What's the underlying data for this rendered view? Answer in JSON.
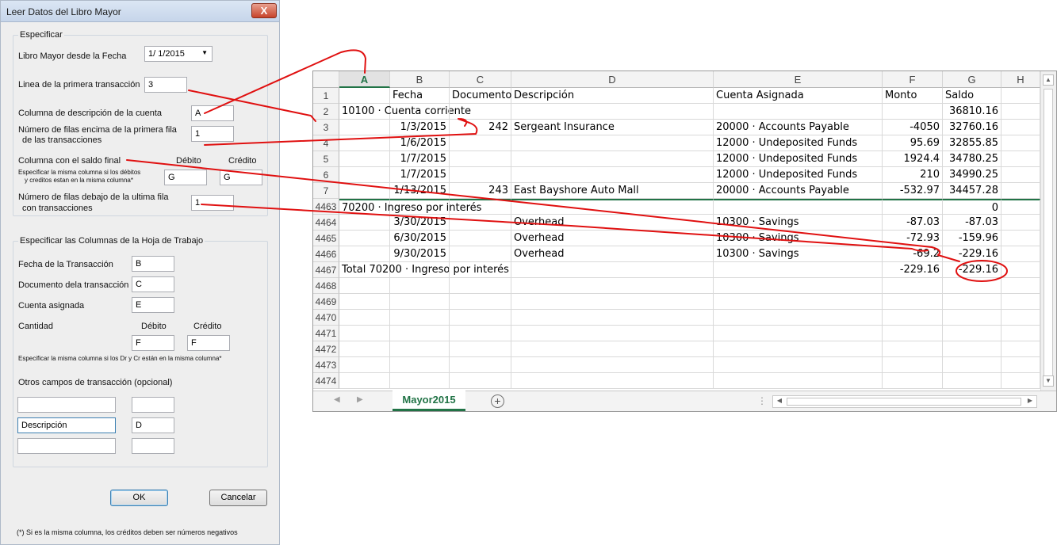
{
  "dialog": {
    "title": "Leer Datos del Libro Mayor",
    "close_label": "X",
    "specify": {
      "legend": "Especificar",
      "ledger_from_date_label": "Libro Mayor desde la Fecha",
      "ledger_from_date_value": "1/  1/2015",
      "first_transaction_line_label": "Linea de la primera transacción",
      "first_transaction_line_value": "3",
      "account_description_column_label": "Columna de descripción de la cuenta",
      "account_description_column_value": "A",
      "rows_above_label_1": "Número de filas encima de la primera fila",
      "rows_above_label_2": "de las transacciones",
      "rows_above_value": "1",
      "final_balance_column_label": "Columna con el saldo final",
      "debit_label": "Débito",
      "credit_label": "Crédito",
      "same_column_note_1": "Especificar la misma columna si los débitos",
      "same_column_note_2": "y creditos estan en la misma columna*",
      "final_balance_debit_value": "G",
      "final_balance_credit_value": "G",
      "rows_below_label_1": "Número de filas debajo de la ultima fila",
      "rows_below_label_2": "con transacciones",
      "rows_below_value": "1"
    },
    "worksheet_columns": {
      "legend": "Especificar las Columnas de la Hoja de Trabajo",
      "transaction_date_label": "Fecha de la Transacción",
      "transaction_date_value": "B",
      "transaction_document_label": "Documento dela transacción",
      "transaction_document_value": "C",
      "assigned_account_label": "Cuenta asignada",
      "assigned_account_value": "E",
      "amount_label": "Cantidad",
      "debit_label": "Débito",
      "credit_label": "Crédito",
      "amount_debit_value": "F",
      "amount_credit_value": "F",
      "same_column_note": "Especificar la misma columna si los Dr y Cr están en la misma columna*",
      "other_fields_label": "Otros campos de transacción (opcional)",
      "other_fields": [
        {
          "name": "",
          "column": ""
        },
        {
          "name": "Descripción",
          "column": "D"
        },
        {
          "name": "",
          "column": ""
        }
      ]
    },
    "ok_label": "OK",
    "cancel_label": "Cancelar",
    "footnote": "(*) Si es la misma columna, los créditos deben ser números negativos"
  },
  "sheet": {
    "columns": [
      "A",
      "B",
      "C",
      "D",
      "E",
      "F",
      "G",
      "H"
    ],
    "selected_column": "A",
    "rows": [
      {
        "num": "1",
        "a": "",
        "b": "Fecha",
        "c": "Documento",
        "d": "Descripción",
        "e": "Cuenta Asignada",
        "f": "Monto",
        "g": "Saldo"
      },
      {
        "num": "2",
        "a": "10100 · Cuenta corriente",
        "b": "",
        "c": "",
        "d": "",
        "e": "",
        "f": "",
        "g": "36810.16"
      },
      {
        "num": "3",
        "a": "",
        "b": "1/3/2015",
        "c": "242",
        "d": "Sergeant Insurance",
        "e": "20000 · Accounts Payable",
        "f": "-4050",
        "g": "32760.16"
      },
      {
        "num": "4",
        "a": "",
        "b": "1/6/2015",
        "c": "",
        "d": "",
        "e": "12000 · Undeposited Funds",
        "f": "95.69",
        "g": "32855.85"
      },
      {
        "num": "5",
        "a": "",
        "b": "1/7/2015",
        "c": "",
        "d": "",
        "e": "12000 · Undeposited Funds",
        "f": "1924.4",
        "g": "34780.25"
      },
      {
        "num": "6",
        "a": "",
        "b": "1/7/2015",
        "c": "",
        "d": "",
        "e": "12000 · Undeposited Funds",
        "f": "210",
        "g": "34990.25"
      },
      {
        "num": "7",
        "a": "",
        "b": "1/13/2015",
        "c": "243",
        "d": "East Bayshore Auto Mall",
        "e": "20000 · Accounts Payable",
        "f": "-532.97",
        "g": "34457.28"
      },
      {
        "num": "4463",
        "a": "70200 · Ingreso por interés",
        "b": "",
        "c": "",
        "d": "",
        "e": "",
        "f": "",
        "g": "0"
      },
      {
        "num": "4464",
        "a": "",
        "b": "3/30/2015",
        "c": "",
        "d": "Overhead",
        "e": "10300 · Savings",
        "f": "-87.03",
        "g": "-87.03"
      },
      {
        "num": "4465",
        "a": "",
        "b": "6/30/2015",
        "c": "",
        "d": "Overhead",
        "e": "10300 · Savings",
        "f": "-72.93",
        "g": "-159.96"
      },
      {
        "num": "4466",
        "a": "",
        "b": "9/30/2015",
        "c": "",
        "d": "Overhead",
        "e": "10300 · Savings",
        "f": "-69.2",
        "g": "-229.16"
      },
      {
        "num": "4467",
        "a": "Total 70200 · Ingreso por interés",
        "b": "",
        "c": "",
        "d": "",
        "e": "",
        "f": "-229.16",
        "g": "-229.16"
      },
      {
        "num": "4468",
        "a": "",
        "b": "",
        "c": "",
        "d": "",
        "e": "",
        "f": "",
        "g": ""
      },
      {
        "num": "4469",
        "a": "",
        "b": "",
        "c": "",
        "d": "",
        "e": "",
        "f": "",
        "g": ""
      },
      {
        "num": "4470",
        "a": "",
        "b": "",
        "c": "",
        "d": "",
        "e": "",
        "f": "",
        "g": ""
      },
      {
        "num": "4471",
        "a": "",
        "b": "",
        "c": "",
        "d": "",
        "e": "",
        "f": "",
        "g": ""
      },
      {
        "num": "4472",
        "a": "",
        "b": "",
        "c": "",
        "d": "",
        "e": "",
        "f": "",
        "g": ""
      },
      {
        "num": "4473",
        "a": "",
        "b": "",
        "c": "",
        "d": "",
        "e": "",
        "f": "",
        "g": ""
      },
      {
        "num": "4474",
        "a": "",
        "b": "",
        "c": "",
        "d": "",
        "e": "",
        "f": "",
        "g": ""
      }
    ],
    "sheet_tab": "Mayor2015",
    "add_sheet_icon": "plus-circle-icon",
    "annotation_color": "#e01010",
    "accent_color": "#217346"
  }
}
